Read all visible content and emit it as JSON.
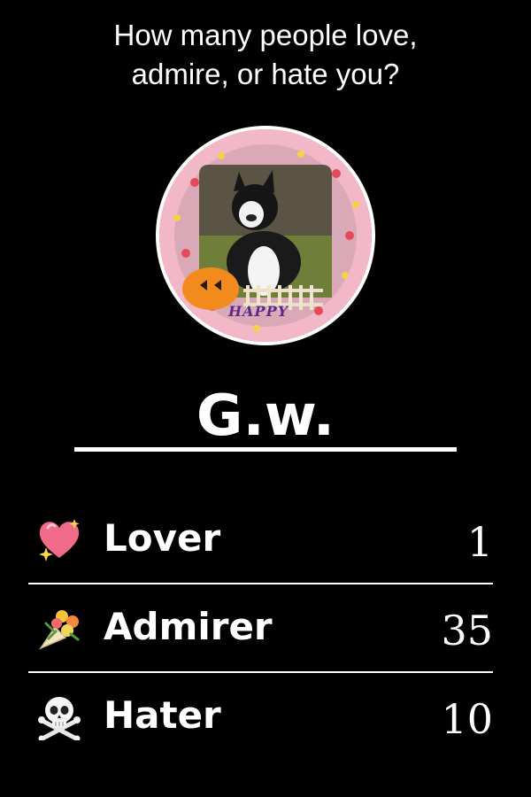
{
  "question": {
    "line1": "How many people love,",
    "line2": "admire, or hate you?"
  },
  "profile": {
    "username": "G.w.",
    "avatar_caption": "HAPPY"
  },
  "stats": [
    {
      "icon": "sparkling-heart-icon",
      "label": "Lover",
      "value": "1"
    },
    {
      "icon": "bouquet-icon",
      "label": "Admirer",
      "value": "35"
    },
    {
      "icon": "skull-crossbones-icon",
      "label": "Hater",
      "value": "10"
    }
  ],
  "colors": {
    "background": "#000000",
    "text": "#ffffff",
    "heart": "#f06a8a"
  }
}
